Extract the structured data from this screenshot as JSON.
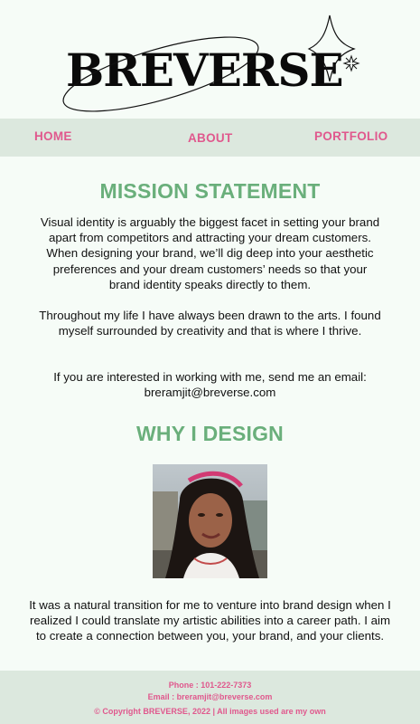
{
  "brand": {
    "logo_text": "BREVERSE"
  },
  "nav": {
    "home": "HOME",
    "about": "ABOUT",
    "portfolio": "PORTFOLIO"
  },
  "mission": {
    "title": "MISSION STATEMENT",
    "paragraph1": "Visual identity is arguably the biggest facet in setting your brand apart from competitors and attracting your dream customers. When designing your brand, we’ll dig deep into your aesthetic preferences and your dream customers’ needs so that your brand identity speaks directly to them.",
    "paragraph2": "Throughout my life I have always been drawn to the arts. I found myself surrounded by creativity and that is where I thrive.",
    "paragraph3": "If you are interested in working with me, send me an email: breramjit@breverse.com"
  },
  "why": {
    "title": "WHY I DESIGN",
    "paragraph": "It was a natural transition for me to venture into brand design when I realized I could translate my artistic abilities into a career path. I aim to create a connection between you, your brand, and your clients."
  },
  "footer": {
    "phone": "Phone : 101-222-7373",
    "email": "Email : breramjit@breverse.com",
    "copyright": "© Copyright BREVERSE, 2022 | All images used are my own"
  },
  "colors": {
    "accent_pink": "#e0588d",
    "heading_green": "#6aaf7b",
    "band_green": "#dce8de",
    "background": "#f6fcf7"
  },
  "icons": [
    "sparkle-large-icon",
    "sparkle-small-icon",
    "orbit-ring-icon"
  ]
}
